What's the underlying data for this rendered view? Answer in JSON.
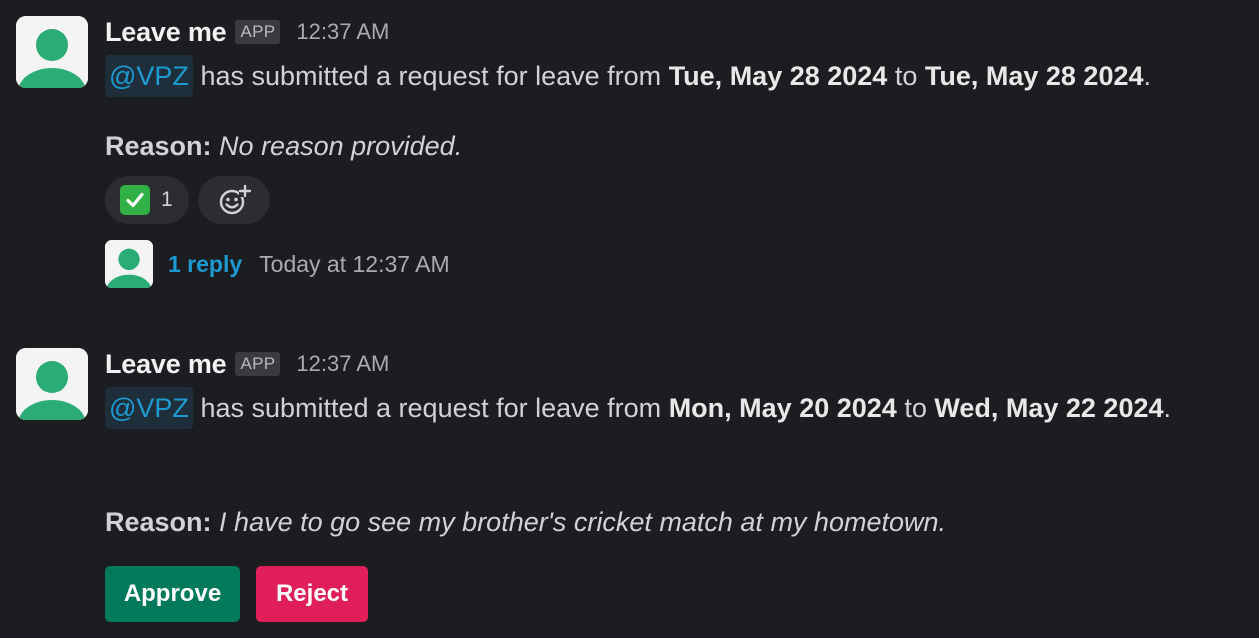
{
  "messages": [
    {
      "sender": "Leave me",
      "badge": "APP",
      "time": "12:37 AM",
      "mention": "@VPZ",
      "text_pre": "has submitted a request for leave from",
      "from_date": "Tue, May 28 2024",
      "to_word": "to",
      "to_date": "Tue, May 28 2024",
      "end_punct": ".",
      "reason_label": "Reason:",
      "reason_text": "No reason provided.",
      "reactions": [
        {
          "emoji": "white-check-mark",
          "count": "1"
        }
      ],
      "add_reaction_icon": "add-emoji-icon",
      "thread": {
        "replies": "1 reply",
        "last_reply": "Today at 12:37 AM"
      }
    },
    {
      "sender": "Leave me",
      "badge": "APP",
      "time": "12:37 AM",
      "mention": "@VPZ",
      "text_pre": "has submitted a request for leave from",
      "from_date": "Mon, May 20 2024",
      "to_word": "to",
      "to_date": "Wed, May 22 2024",
      "end_punct": ".",
      "reason_label": "Reason:",
      "reason_text": "I have to go see my brother's cricket match at my hometown.",
      "actions": {
        "approve": "Approve",
        "reject": "Reject"
      }
    }
  ],
  "colors": {
    "background": "#1b1d21",
    "mention": "#1d9bd1",
    "approve": "#007a5a",
    "reject": "#e01e5a",
    "avatar_figure": "#2bac76"
  }
}
